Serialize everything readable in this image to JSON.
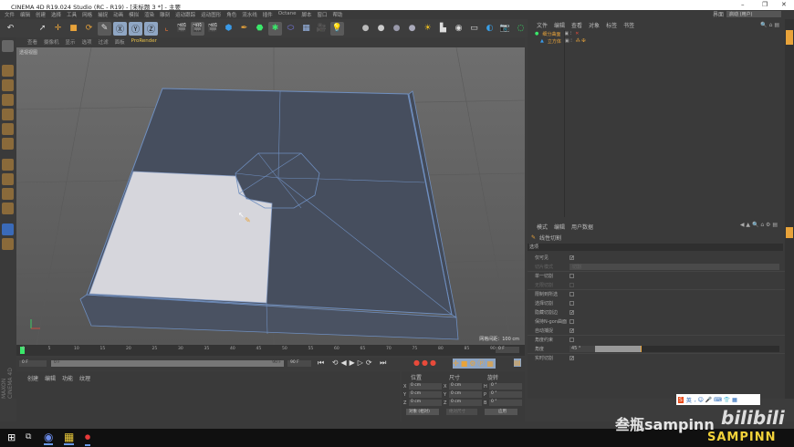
{
  "window": {
    "title": "CINEMA 4D R19.024 Studio (RC - R19) - [未标题 3 *] - 主要",
    "controls": [
      "–",
      "❐",
      "✕"
    ]
  },
  "menu": [
    "文件",
    "编辑",
    "创建",
    "选择",
    "工具",
    "网格",
    "捕捉",
    "动画",
    "模拟",
    "渲染",
    "雕刻",
    "运动跟踪",
    "运动图形",
    "角色",
    "流水线",
    "插件",
    "Octane",
    "脚本",
    "窗口",
    "帮助"
  ],
  "layout": {
    "label": "界面",
    "value": "启动 (用户)"
  },
  "viewport": {
    "menu": [
      "查看",
      "摄像机",
      "显示",
      "选项",
      "过滤",
      "面板",
      "ProRender"
    ],
    "name": "透视视图",
    "grid_info": "网格间距：100 cm"
  },
  "object_manager": {
    "menu": [
      "文件",
      "编辑",
      "查看",
      "对象",
      "标签",
      "书签"
    ],
    "objects": [
      {
        "name": "细分曲面",
        "color": "#e8a33a"
      },
      {
        "name": "立方体",
        "color": "#e8a33a"
      }
    ]
  },
  "attributes": {
    "menu": [
      "模式",
      "编辑",
      "用户数据"
    ],
    "tool": "线性切割",
    "section": "选项",
    "fields": [
      {
        "label": "仅可见",
        "checked": true
      },
      {
        "label": "切片模式",
        "value": "切割",
        "disabled": true
      },
      {
        "label": "单一切割",
        "checked": false
      },
      {
        "label": "无限切割",
        "checked": false,
        "disabled": true
      },
      {
        "label": "限制到所选",
        "checked": false
      },
      {
        "label": "选择切割",
        "checked": false
      },
      {
        "label": "隐藏切割边",
        "checked": true
      },
      {
        "label": "保持N-gon曲面",
        "checked": false
      },
      {
        "label": "自动捕捉",
        "checked": true
      },
      {
        "label": "角度约束",
        "checked": false
      },
      {
        "label": "角度",
        "value": "45 °",
        "slider": 0.25
      },
      {
        "label": "实时切割",
        "checked": true
      }
    ]
  },
  "timeline": {
    "ticks": [
      "0",
      "5",
      "10",
      "15",
      "20",
      "25",
      "30",
      "35",
      "40",
      "45",
      "50",
      "55",
      "60",
      "65",
      "70",
      "75",
      "80",
      "85",
      "90"
    ],
    "current": "0 F",
    "start": "0 F",
    "end": "90 F",
    "range_start": "0 F",
    "range_end": "90 F"
  },
  "material_manager": {
    "menu": [
      "创建",
      "编辑",
      "功能",
      "纹理"
    ]
  },
  "coordinates": {
    "headers": [
      "位置",
      "尺寸",
      "旋转"
    ],
    "rows": [
      [
        "X",
        "0 cm",
        "X",
        "0 cm",
        "H",
        "0 °"
      ],
      [
        "Y",
        "0 cm",
        "Y",
        "0 cm",
        "P",
        "0 °"
      ],
      [
        "Z",
        "0 cm",
        "Z",
        "0 cm",
        "B",
        "0 °"
      ]
    ],
    "mode": "对象 (相对)",
    "size_mode": "绝对尺寸",
    "apply": "应用"
  },
  "branding": {
    "maxon": "MAXON CINEMA 4D",
    "watermark": "叁瓶sampinn",
    "bilibili": "bilibili",
    "sampinn": "SAMPINN",
    "ime": "英"
  }
}
